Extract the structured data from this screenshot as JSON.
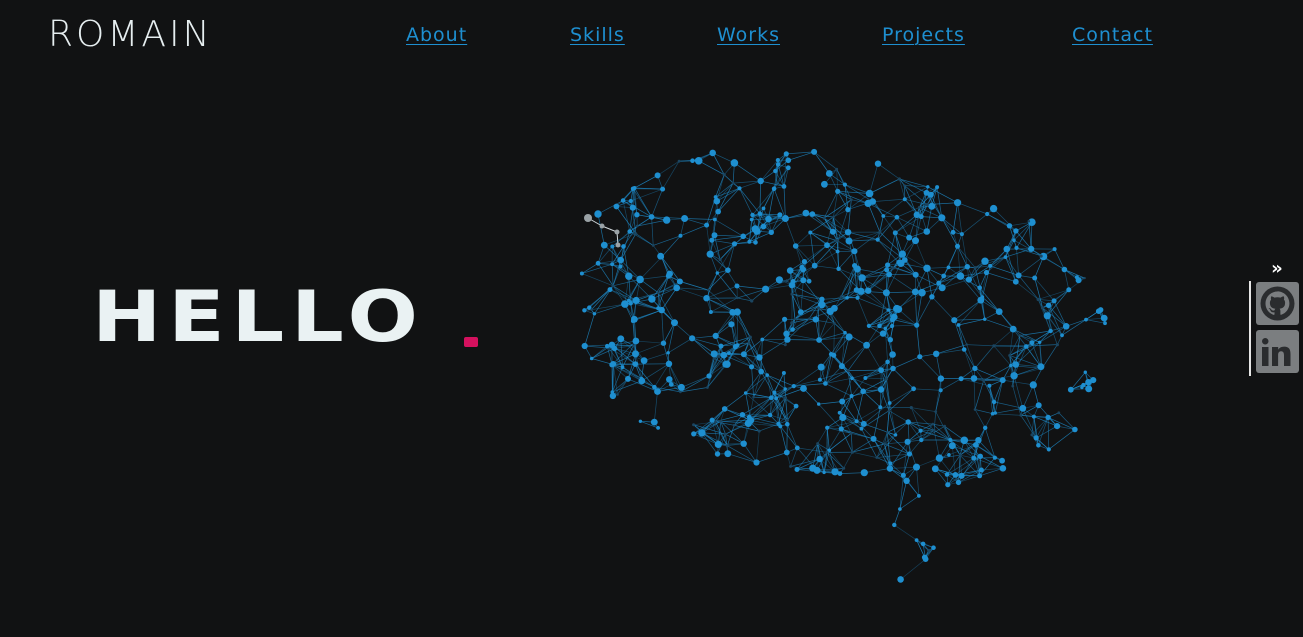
{
  "header": {
    "logo": "ROMAIN",
    "nav": [
      {
        "label": "About"
      },
      {
        "label": "Skills"
      },
      {
        "label": "Works"
      },
      {
        "label": "Projects"
      },
      {
        "label": "Contact"
      }
    ]
  },
  "hero": {
    "title": "HELLO",
    "accent_color": "#d4115e",
    "brain_color": "#1e8fd0"
  },
  "social": {
    "toggle": "»",
    "links": [
      {
        "icon": "github-icon"
      },
      {
        "icon": "linkedin-icon"
      }
    ]
  }
}
